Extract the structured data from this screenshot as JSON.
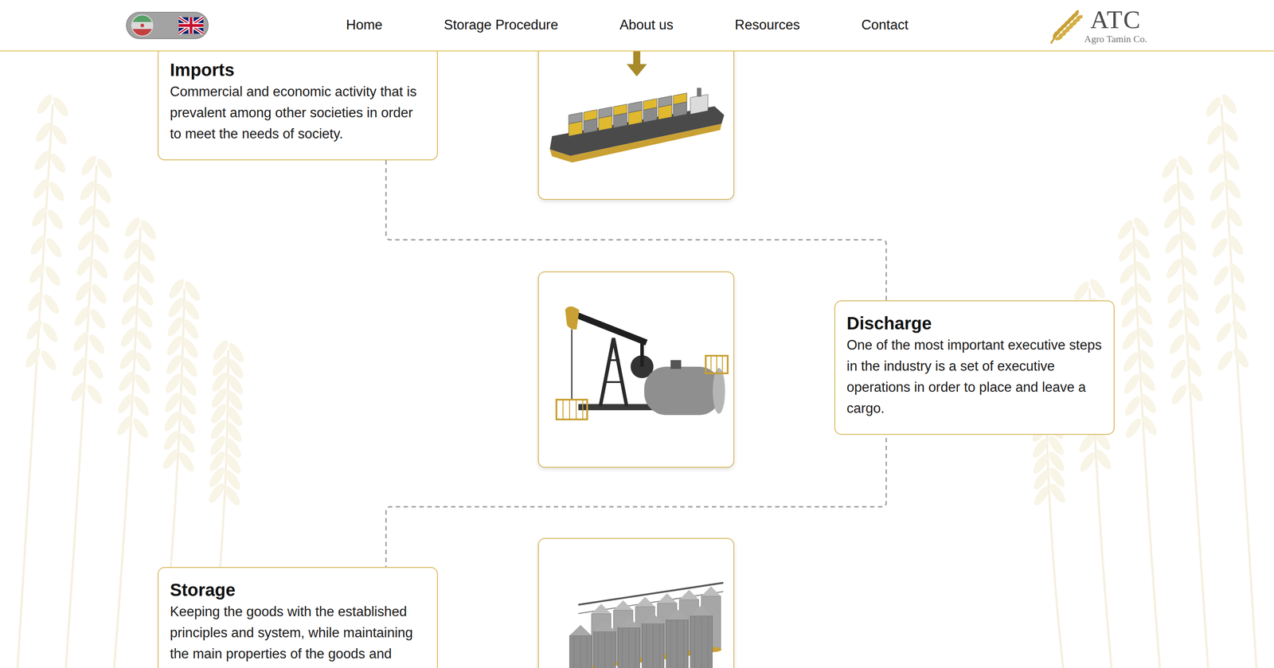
{
  "header": {
    "language_toggle": {
      "options": [
        {
          "kind": "iran",
          "selected": false
        },
        {
          "kind": "uk",
          "selected": true
        }
      ]
    },
    "nav": {
      "items": [
        {
          "label": "Home"
        },
        {
          "label": "Storage Procedure"
        },
        {
          "label": "About us"
        },
        {
          "label": "Resources"
        },
        {
          "label": "Contact"
        }
      ]
    },
    "logo": {
      "mark": "ATC",
      "name": "Agro Tamin Co."
    }
  },
  "steps": [
    {
      "title": "Imports",
      "text": "Commercial and economic activity that is prevalent among other societies in order to meet the needs of society.",
      "kind": "ship"
    },
    {
      "title": "Discharge",
      "text": "One of the most important executive steps in the industry is a set of executive operations in order to place and leave a cargo.",
      "kind": "pump"
    },
    {
      "title": "Storage",
      "text": "Keeping the goods with the established principles and system, while maintaining the main properties of the goods and",
      "kind": "silo"
    }
  ]
}
